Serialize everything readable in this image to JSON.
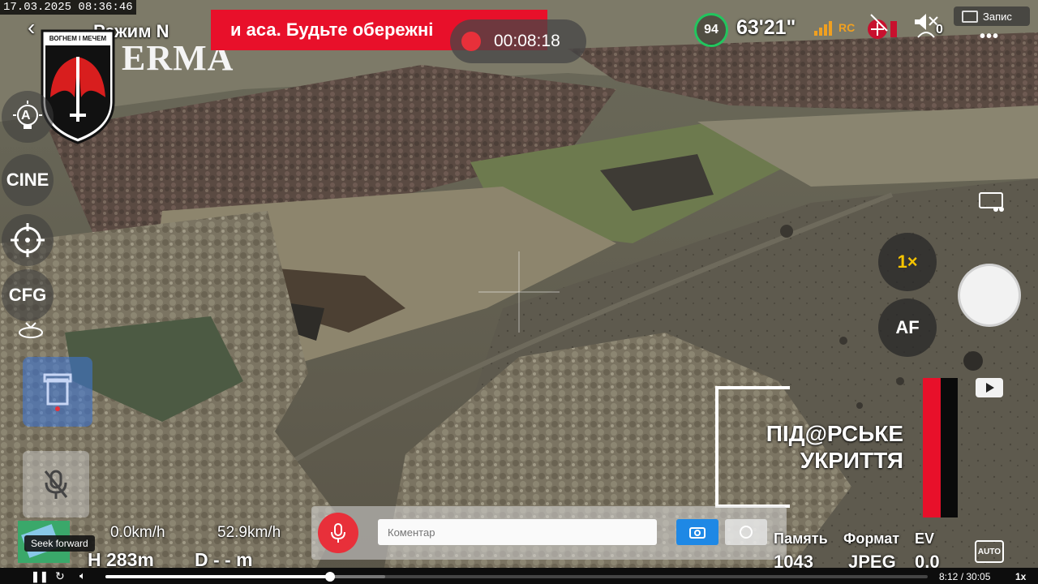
{
  "overlay": {
    "timestamp": "17.03.2025  08:36:46",
    "mode_label": "Режим N",
    "brand_text": "ERMA",
    "alert_text": "и аса. Будьте обережні",
    "rec_timer": "00:08:18",
    "battery_percent": "94",
    "flight_time": "63'21\"",
    "rc_label": "RC",
    "mute_count": "0",
    "record_button": "Запис",
    "more_icon": "more-dots-icon"
  },
  "emblem": {
    "text": "ВОГНЕМ І МЕЧЕМ"
  },
  "left_panel": {
    "auto_exposure": "A",
    "cine": "CINE",
    "cfg": "CFG",
    "seek_tooltip": "Seek forward"
  },
  "right_panel": {
    "zoom": "1×",
    "af": "AF"
  },
  "watermark": {
    "line1": "ПІД@РСЬКЕ",
    "line2": "УКРИТТЯ"
  },
  "telemetry": {
    "vertical_speed": "0.0km/h",
    "horizontal_speed": "52.9km/h",
    "height": "H 283m",
    "distance": "D - - m"
  },
  "comment_bar": {
    "placeholder": "Коментар"
  },
  "camera_info": {
    "memory_label": "Память",
    "format_label": "Формат",
    "ev_label": "EV",
    "memory_value": "1043",
    "format_value": "JPEG",
    "ev_value": "0.0",
    "auto_label": "AUTO"
  },
  "player": {
    "time": "8:12 / 30:05",
    "speed": "1x",
    "progress": 0.273,
    "buffered": 0.34
  },
  "colors": {
    "alert_red": "#e8102a",
    "battery_green": "#22c55e",
    "mic_red": "#e8303a",
    "camera_blue": "#1e88e5"
  }
}
